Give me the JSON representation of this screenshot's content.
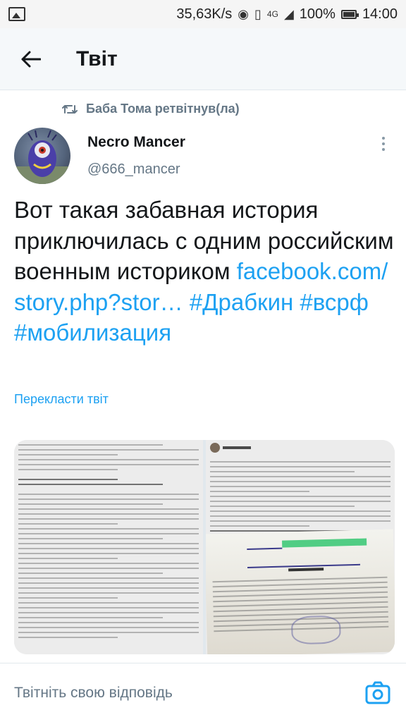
{
  "status_bar": {
    "speed": "35,63K/s",
    "network": "4G",
    "battery": "100%",
    "time": "14:00"
  },
  "header": {
    "title": "Твіт"
  },
  "retweet": {
    "label": "Баба Тома ретвітнув(ла)"
  },
  "author": {
    "name": "Necro Mancer",
    "handle": "@666_mancer"
  },
  "tweet": {
    "text": "Вот такая забавная история приключилась с одним российским военным историком ",
    "link": "facebook.com/ story.php?stor…",
    "hashtags": [
      "#Драбкин",
      "#всрф",
      "#мобилизация"
    ],
    "translate_label": "Перекласти твіт"
  },
  "media": {
    "count": 2,
    "image_2_author": "Artem Drabkin",
    "image_2_doc_title": "ПОВЕСТКА"
  },
  "reply": {
    "placeholder": "Твітніть свою відповідь"
  },
  "colors": {
    "accent": "#1da1f2",
    "secondary_text": "#657786",
    "primary_text": "#14171a"
  },
  "icons": [
    "back-arrow-icon",
    "retweet-icon",
    "more-icon",
    "camera-icon"
  ]
}
